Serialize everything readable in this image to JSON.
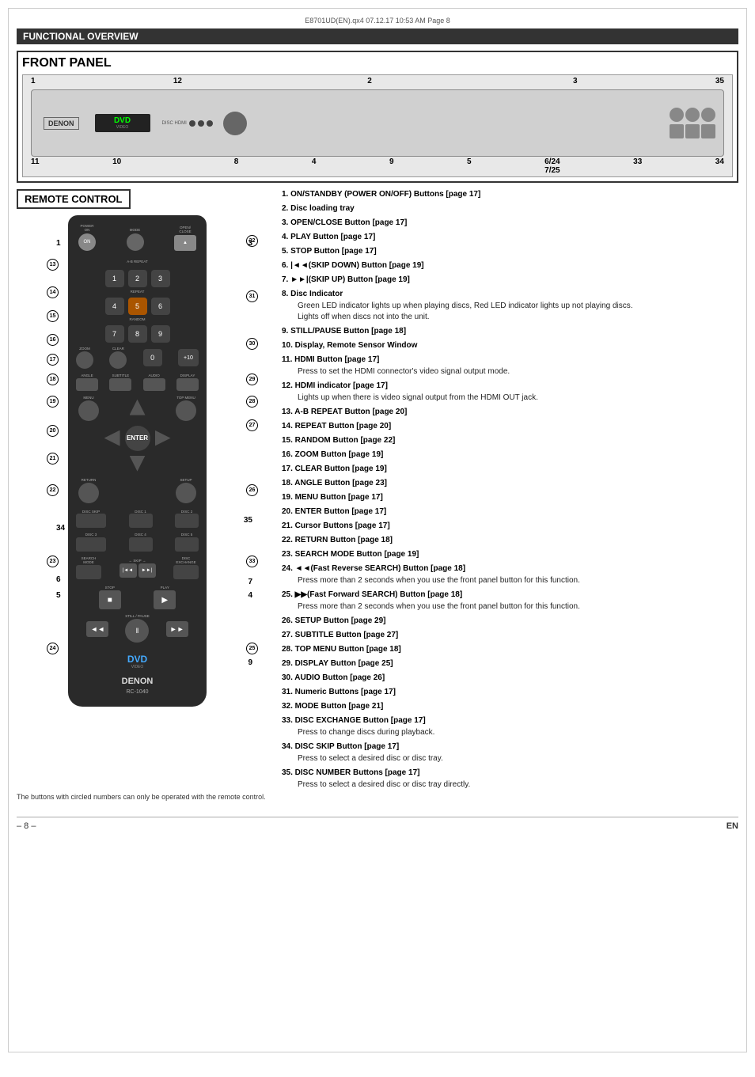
{
  "header": {
    "file_info": "E8701UD(EN).qx4  07.12.17  10:53 AM  Page 8"
  },
  "functional_overview": {
    "title": "FUNCTIONAL OVERVIEW"
  },
  "front_panel": {
    "title": "FRONT PANEL",
    "numbers_top": [
      "1",
      "12",
      "2",
      "3",
      "35"
    ],
    "numbers_bottom": [
      "11",
      "10",
      "8",
      "4",
      "9",
      "5",
      "6/24",
      "7/25",
      "33",
      "34"
    ],
    "logo": "DENON",
    "display_text": "DVD"
  },
  "remote_control": {
    "title": "REMOTE CONTROL",
    "logo": "DVD",
    "brand": "DENON",
    "model": "RC-1040"
  },
  "annotations": {
    "circled": [
      "13",
      "14",
      "15",
      "16",
      "17",
      "18",
      "19",
      "20",
      "21",
      "22",
      "23",
      "24",
      "25",
      "26",
      "27",
      "28",
      "29",
      "30",
      "31",
      "32",
      "33",
      "34",
      "35"
    ],
    "plain": [
      "1",
      "3",
      "4",
      "5",
      "6",
      "7",
      "9",
      "34",
      "35"
    ]
  },
  "items": [
    {
      "num": "1",
      "text": "ON/STANDBY (POWER ON/OFF) Buttons [page 17]"
    },
    {
      "num": "2",
      "text": "Disc loading tray"
    },
    {
      "num": "3",
      "text": "OPEN/CLOSE Button [page 17]"
    },
    {
      "num": "4",
      "text": "PLAY Button [page 17]"
    },
    {
      "num": "5",
      "text": "STOP Button [page 17]"
    },
    {
      "num": "6",
      "text": "|◄◄(SKIP DOWN) Button [page 19]"
    },
    {
      "num": "7",
      "text": "►►|(SKIP UP) Button [page 19]"
    },
    {
      "num": "8",
      "text": "Disc Indicator",
      "sub": "Green LED indicator lights up when playing discs, Red LED indicator lights up not playing discs. Lights off when discs not into the unit."
    },
    {
      "num": "9",
      "text": "STILL/PAUSE Button [page 18]"
    },
    {
      "num": "10",
      "text": "Display, Remote Sensor Window"
    },
    {
      "num": "11",
      "text": "HDMI Button [page 17]",
      "sub": "Press to set the HDMI connector's video signal output mode."
    },
    {
      "num": "12",
      "text": "HDMI indicator [page 17]",
      "sub": "Lights up when there is video signal output from the HDMI OUT jack."
    },
    {
      "num": "13",
      "text": "A-B REPEAT Button [page 20]"
    },
    {
      "num": "14",
      "text": "REPEAT Button [page 20]"
    },
    {
      "num": "15",
      "text": "RANDOM Button [page 22]"
    },
    {
      "num": "16",
      "text": "ZOOM Button [page 19]"
    },
    {
      "num": "17",
      "text": "CLEAR Button [page 19]"
    },
    {
      "num": "18",
      "text": "ANGLE Button [page 23]"
    },
    {
      "num": "19",
      "text": "MENU Button [page 17]"
    },
    {
      "num": "20",
      "text": "ENTER Button [page 17]"
    },
    {
      "num": "21",
      "text": "Cursor Buttons [page 17]"
    },
    {
      "num": "22",
      "text": "RETURN Button [page 18]"
    },
    {
      "num": "23",
      "text": "SEARCH MODE Button [page 19]"
    },
    {
      "num": "24",
      "text": "◄◄(Fast Reverse SEARCH) Button [page 18]",
      "sub": "Press more than 2 seconds when you use the front panel button for this function."
    },
    {
      "num": "25",
      "text": "►►(Fast Forward SEARCH) Button [page 18]",
      "sub": "Press more than 2 seconds when you use the front panel button for this function."
    },
    {
      "num": "26",
      "text": "SETUP Button [page 29]"
    },
    {
      "num": "27",
      "text": "SUBTITLE Button [page 27]"
    },
    {
      "num": "28",
      "text": "TOP MENU Button [page 18]"
    },
    {
      "num": "29",
      "text": "DISPLAY Button [page 25]"
    },
    {
      "num": "30",
      "text": "AUDIO Button [page 26]"
    },
    {
      "num": "31",
      "text": "Numeric Buttons [page 17]"
    },
    {
      "num": "32",
      "text": "MODE Button [page 21]"
    },
    {
      "num": "33",
      "text": "DISC EXCHANGE Button [page 17]",
      "sub": "Press to change discs during playback."
    },
    {
      "num": "34",
      "text": "DISC SKIP Button [page 17]",
      "sub": "Press to select a desired disc or disc tray."
    },
    {
      "num": "35",
      "text": "DISC NUMBER Buttons [page 17]",
      "sub": "Press to select a desired disc or disc tray directly."
    }
  ],
  "footnote": "The buttons with circled numbers can only be operated with the remote control.",
  "page": {
    "number": "– 8 –",
    "language": "EN"
  }
}
